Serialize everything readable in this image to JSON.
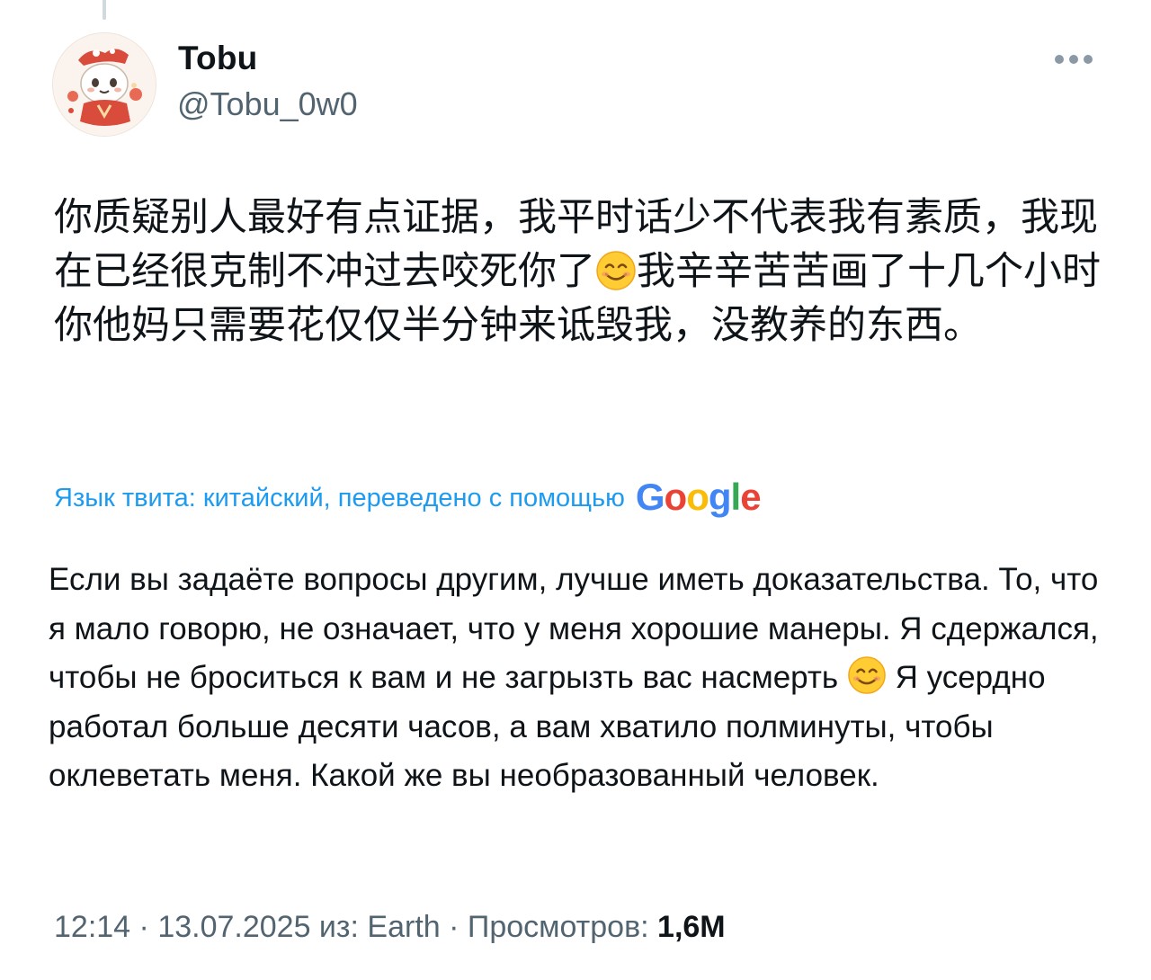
{
  "author": {
    "display_name": "Tobu",
    "handle": "@Tobu_0w0",
    "avatar_icon": "avatar-illustration"
  },
  "actions": {
    "more_icon": "more-horizontal-icon"
  },
  "tweet": {
    "text_part1": "你质疑别人最好有点证据，我平时话少不代表我有素质，我现在已经很克制不冲过去咬死你了",
    "emoji_name": "smiling-face-emoji",
    "text_part2": "我辛辛苦苦画了十几个小时你他妈只需要花仅仅半分钟来诋毁我，没教养的东西。"
  },
  "translation": {
    "label": "Язык твита: китайский, переведено с помощью",
    "provider": "Google",
    "text_part1": "Если вы задаёте вопросы другим, лучше иметь доказательства. То, что я мало говорю, не означает, что у меня хорошие манеры. Я сдержался, чтобы не броситься к вам и не загрызть вас насмерть",
    "text_part2": " Я усердно работал больше десяти часов, а вам хватило полминуты, чтобы оклеветать меня. Какой же вы необразованный человек."
  },
  "meta": {
    "time": "12:14",
    "separator1": " · ",
    "date": "13.07.2025",
    "source_prefix": " из: ",
    "source": "Earth",
    "separator2": " · ",
    "views_label": "Просмотров: ",
    "views_count": "1,6M"
  },
  "colors": {
    "link_blue": "#1d9bf0",
    "secondary_text": "#536471",
    "primary_text": "#0f1419"
  }
}
